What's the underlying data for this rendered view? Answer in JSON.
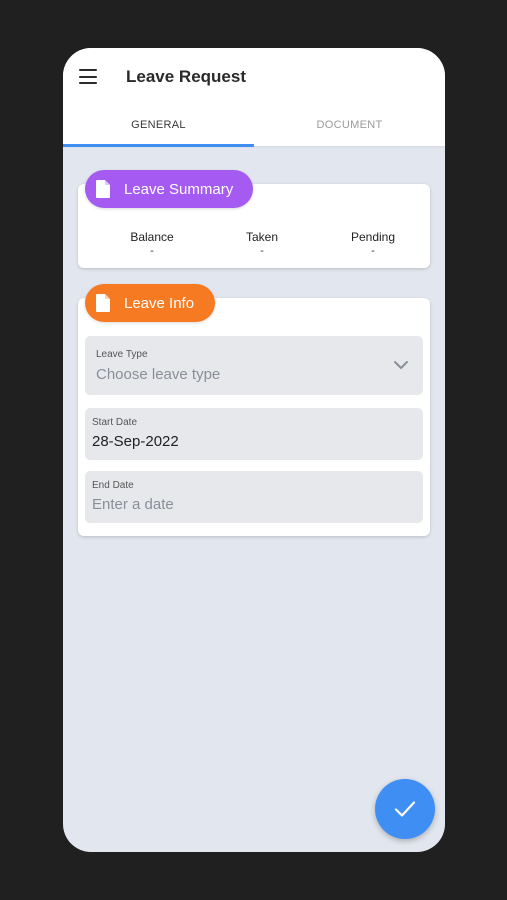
{
  "appbar": {
    "title": "Leave Request"
  },
  "tabs": [
    {
      "label": "GENERAL",
      "active": true
    },
    {
      "label": "DOCUMENT",
      "active": false
    }
  ],
  "summary": {
    "header": "Leave Summary",
    "color": "#a55af1",
    "stats": [
      {
        "label": "Balance",
        "value": "-"
      },
      {
        "label": "Taken",
        "value": "-"
      },
      {
        "label": "Pending",
        "value": "-"
      }
    ]
  },
  "info": {
    "header": "Leave Info",
    "color": "#f57a22",
    "leave_type": {
      "label": "Leave Type",
      "placeholder": "Choose leave type"
    },
    "start_date": {
      "label": "Start Date",
      "value": "28-Sep-2022"
    },
    "end_date": {
      "label": "End Date",
      "placeholder": "Enter a date"
    }
  },
  "fab": {
    "icon": "check-icon",
    "color": "#3f8ef4"
  },
  "icons": {
    "menu": "menu-icon",
    "document": "document-icon",
    "dropdown": "chevron-down-icon"
  }
}
